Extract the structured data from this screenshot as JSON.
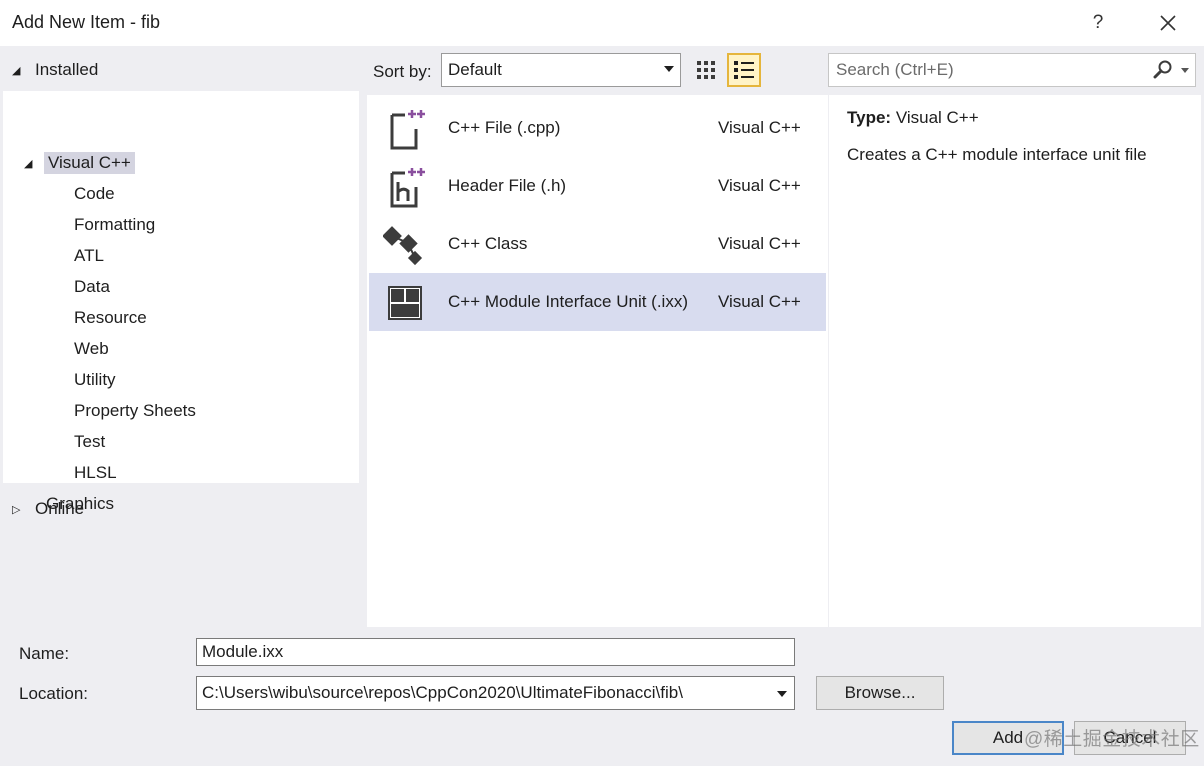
{
  "window": {
    "title": "Add New Item - fib",
    "help_label": "?",
    "close_label": "✕"
  },
  "sidebar": {
    "installed_label": "Installed",
    "root_label": "Visual C++",
    "children": [
      "Code",
      "Formatting",
      "ATL",
      "Data",
      "Resource",
      "Web",
      "Utility",
      "Property Sheets",
      "Test",
      "HLSL"
    ],
    "sibling_label": "Graphics",
    "online_label": "Online",
    "expanded_glyph": "◢",
    "collapsed_glyph": "▷"
  },
  "toolbar": {
    "sort_label": "Sort by:",
    "sort_value": "Default",
    "search_placeholder": "Search (Ctrl+E)",
    "active_view": "list"
  },
  "templates": [
    {
      "name": "C++ File (.cpp)",
      "lang": "Visual C++",
      "icon": "cpp-file-icon",
      "selected": false
    },
    {
      "name": "Header File (.h)",
      "lang": "Visual C++",
      "icon": "header-file-icon",
      "selected": false
    },
    {
      "name": "C++ Class",
      "lang": "Visual C++",
      "icon": "class-icon",
      "selected": false
    },
    {
      "name": "C++ Module Interface Unit (.ixx)",
      "lang": "Visual C++",
      "icon": "module-icon",
      "selected": true
    }
  ],
  "details": {
    "type_key": "Type:",
    "type_value": "Visual C++",
    "description": "Creates a C++ module interface unit file"
  },
  "form": {
    "name_label": "Name:",
    "name_value": "Module.ixx",
    "location_label": "Location:",
    "location_value": "C:\\Users\\wibu\\source\\repos\\CppCon2020\\UltimateFibonacci\\fib\\",
    "browse_label": "Browse...",
    "add_label": "Add",
    "cancel_label": "Cancel"
  },
  "watermark": "@稀土掘金技术社区",
  "colors": {
    "selection": "#d8dcef",
    "tree_selection": "#d4d4e0",
    "panel_bg": "#eeeef2",
    "accent_plus": "#8a4f9e",
    "active_view_border": "#e5b53c"
  }
}
